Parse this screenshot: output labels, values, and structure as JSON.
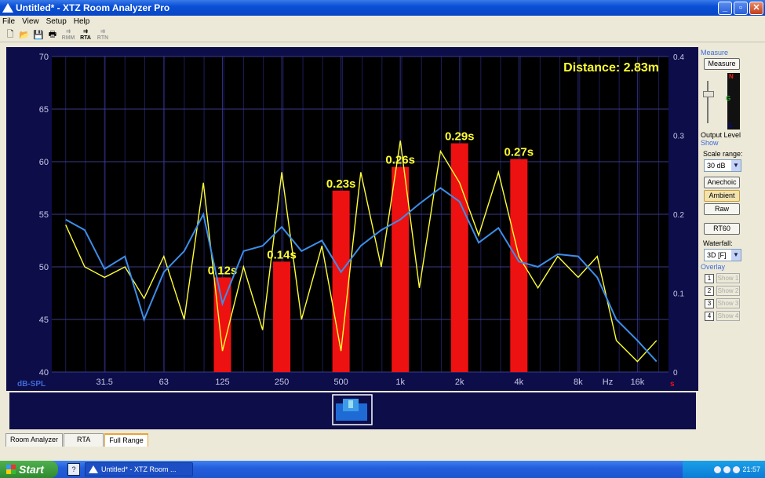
{
  "window": {
    "title": "Untitled* - XTZ Room Analyzer Pro",
    "minimize": "_",
    "maximize": "▫",
    "close": "✕"
  },
  "menu": [
    "File",
    "View",
    "Setup",
    "Help"
  ],
  "toolbar": {
    "new_icon": "new-file-icon",
    "open_icon": "open-folder-icon",
    "save_icon": "save-disk-icon",
    "print_icon": "printer-icon",
    "rmm": "RMM",
    "rta": "RTA",
    "rtn": "RTN"
  },
  "chart": {
    "distance": "Distance: 2.83m",
    "y_left": {
      "label": "dB-SPL",
      "ticks": [
        "70",
        "65",
        "60",
        "55",
        "50",
        "45",
        "40"
      ]
    },
    "y_right": {
      "unit": "s",
      "ticks": [
        "0.4",
        "0.3",
        "0.2",
        "0.1",
        "0"
      ]
    },
    "x_ticks": [
      "31.5",
      "63",
      "125",
      "250",
      "500",
      "1k",
      "2k",
      "4k",
      "8k",
      "Hz",
      "16k"
    ]
  },
  "chart_data": {
    "type": "line",
    "x_scale": "log",
    "xlim": [
      17,
      23000
    ],
    "ylim": [
      40,
      70
    ],
    "y2lim": [
      0,
      0.4
    ],
    "grid": true,
    "series": [
      {
        "color": "#ffff33",
        "x": [
          20,
          25,
          31.5,
          40,
          50,
          63,
          80,
          100,
          125,
          160,
          200,
          250,
          315,
          400,
          500,
          630,
          800,
          1000,
          1250,
          1600,
          2000,
          2500,
          3150,
          4000,
          5000,
          6300,
          8000,
          10000,
          12500,
          16000,
          20000
        ],
        "values": [
          54,
          50,
          49,
          50,
          47,
          51,
          45,
          58,
          42,
          50,
          44,
          59,
          45,
          52,
          42,
          59,
          50,
          62,
          48,
          61,
          58,
          53,
          59,
          51,
          48,
          51,
          49,
          51,
          43,
          41,
          43
        ]
      },
      {
        "color": "#3d8ee8",
        "x": [
          20,
          25,
          31.5,
          40,
          50,
          63,
          80,
          100,
          125,
          160,
          200,
          250,
          315,
          400,
          500,
          630,
          800,
          1000,
          1250,
          1600,
          2000,
          2500,
          3150,
          4000,
          5000,
          6300,
          8000,
          10000,
          12500,
          16000,
          20000
        ],
        "values": [
          54.5,
          53.5,
          49.8,
          51,
          45,
          49.5,
          51.5,
          55,
          46.5,
          51.5,
          52,
          53.8,
          51.5,
          52.5,
          49.5,
          52,
          53.5,
          54.5,
          56,
          57.5,
          56.2,
          52.3,
          53.7,
          50.5,
          50,
          51.2,
          51,
          49,
          45,
          43,
          41
        ]
      },
      {
        "name": "RT60",
        "type": "bar",
        "axis": "right",
        "color": "#ee1111",
        "x": [
          125,
          250,
          500,
          1000,
          2000,
          4000
        ],
        "values": [
          0.12,
          0.14,
          0.23,
          0.26,
          0.29,
          0.27
        ],
        "labels": [
          "0.12s",
          "0.14s",
          "0.23s",
          "0.26s",
          "0.29s",
          "0.27s"
        ]
      }
    ]
  },
  "panel": {
    "measure_title": "Measure",
    "measure_btn": "Measure",
    "meter_n": "N",
    "meter_g": "G",
    "meter_l": "L",
    "output_level": "Output Level",
    "show_title": "Show",
    "scale_label": "Scale range:",
    "scale_value": "30 dB",
    "anechoic": "Anechoic",
    "ambient": "Ambient",
    "raw": "Raw",
    "rt60": "RT60",
    "waterfall_label": "Waterfall:",
    "waterfall_value": "3D [F]",
    "overlay_title": "Overlay",
    "overlays": [
      {
        "n": "1",
        "label": "Show 1"
      },
      {
        "n": "2",
        "label": "Show 2"
      },
      {
        "n": "3",
        "label": "Show 3"
      },
      {
        "n": "4",
        "label": "Show 4"
      }
    ]
  },
  "tabs": [
    "Room Analyzer",
    "RTA",
    "Full Range"
  ],
  "taskbar": {
    "start": "Start",
    "help": "?",
    "task": "Untitled* - XTZ Room ...",
    "time": "21:57"
  }
}
